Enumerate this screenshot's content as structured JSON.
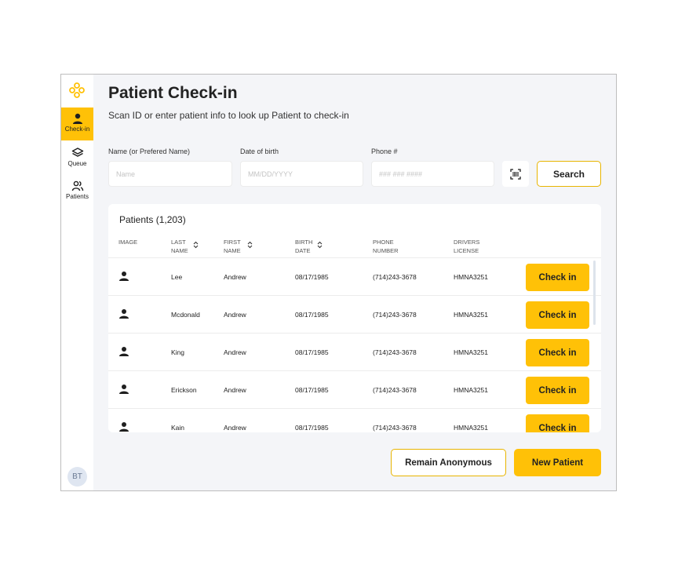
{
  "sidebar": {
    "items": [
      {
        "label": "Check-in",
        "icon": "person-icon",
        "active": true
      },
      {
        "label": "Queue",
        "icon": "layers-icon",
        "active": false
      },
      {
        "label": "Patients",
        "icon": "people-icon",
        "active": false
      }
    ],
    "avatar_initials": "BT"
  },
  "header": {
    "title": "Patient Check-in",
    "subtitle": "Scan ID or enter patient info to look up Patient to check-in"
  },
  "search": {
    "name_label": "Name (or Prefered Name)",
    "name_placeholder": "Name",
    "dob_label": "Date of birth",
    "dob_placeholder": "MM/DD/YYYY",
    "phone_label": "Phone #",
    "phone_placeholder": "### ### ####",
    "scan_icon": "barcode-scan-icon",
    "search_label": "Search"
  },
  "patients": {
    "title": "Patients (1,203)",
    "columns": {
      "image": "IMAGE",
      "last_name": "LAST NAME",
      "first_name": "FIRST NAME",
      "birth_date": "BIRTH DATE",
      "phone": "PHONE NUMBER",
      "license": "DRIVERS LICENSE"
    },
    "checkin_label": "Check in",
    "rows": [
      {
        "last": "Lee",
        "first": "Andrew",
        "dob": "08/17/1985",
        "phone": "(714)243-3678",
        "license": "HMNA3251"
      },
      {
        "last": "Mcdonald",
        "first": "Andrew",
        "dob": "08/17/1985",
        "phone": "(714)243-3678",
        "license": "HMNA3251"
      },
      {
        "last": "King",
        "first": "Andrew",
        "dob": "08/17/1985",
        "phone": "(714)243-3678",
        "license": "HMNA3251"
      },
      {
        "last": "Erickson",
        "first": "Andrew",
        "dob": "08/17/1985",
        "phone": "(714)243-3678",
        "license": "HMNA3251"
      },
      {
        "last": "Kain",
        "first": "Andrew",
        "dob": "08/17/1985",
        "phone": "(714)243-3678",
        "license": "HMNA3251"
      }
    ]
  },
  "footer": {
    "anonymous_label": "Remain Anonymous",
    "new_patient_label": "New Patient"
  },
  "colors": {
    "accent": "#ffc107",
    "accent_border": "#e8b400",
    "background": "#f4f5f8"
  }
}
